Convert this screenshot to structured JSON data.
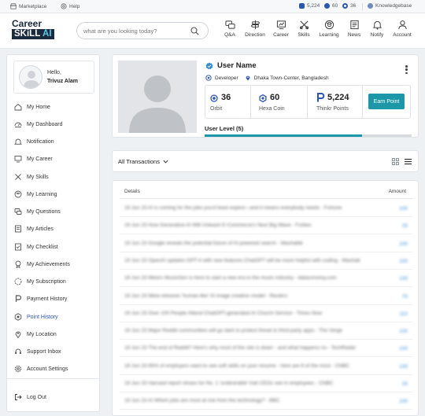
{
  "topbar": {
    "marketplace": "Marketplace",
    "help": "Help",
    "points": "5,224",
    "hexa": "60",
    "orbit": "36",
    "knowledgebase": "Knowledgebase"
  },
  "header": {
    "logo_top": "Career",
    "logo_bottom": "SKiLL",
    "logo_ai": "AI",
    "search_placeholder": "what are you looking today?",
    "nav": [
      "Q&A",
      "Direction",
      "Career",
      "Skills",
      "Learning",
      "News",
      "Notify",
      "Account"
    ]
  },
  "sidebar": {
    "greeting": "Hello,",
    "user": "Trivuz Alam",
    "items": [
      {
        "label": "My Home",
        "icon": "home-icon"
      },
      {
        "label": "My Dashboard",
        "icon": "dashboard-icon"
      },
      {
        "label": "Notification",
        "icon": "bell-icon"
      },
      {
        "label": "My Career",
        "icon": "career-icon"
      },
      {
        "label": "My Skills",
        "icon": "skills-icon"
      },
      {
        "label": "My Learning",
        "icon": "learning-icon"
      },
      {
        "label": "My Questions",
        "icon": "questions-icon"
      },
      {
        "label": "My Articles",
        "icon": "articles-icon"
      },
      {
        "label": "My Checklist",
        "icon": "checklist-icon"
      },
      {
        "label": "My Achievements",
        "icon": "achievements-icon"
      },
      {
        "label": "My Subscription",
        "icon": "subscription-icon"
      },
      {
        "label": "Payment History",
        "icon": "payment-icon"
      },
      {
        "label": "Point History",
        "icon": "points-icon",
        "active": true
      },
      {
        "label": "My Location",
        "icon": "location-icon"
      },
      {
        "label": "Support Inbox",
        "icon": "support-icon"
      },
      {
        "label": "Account Settings",
        "icon": "settings-icon"
      }
    ],
    "logout": "Log Out"
  },
  "profile": {
    "name": "User Name",
    "role": "Developer",
    "location": "Dhaka Town-Center, Bangladesh",
    "stats": [
      {
        "value": "36",
        "label": "Orbit"
      },
      {
        "value": "60",
        "label": "Hexa Coin"
      },
      {
        "value": "5,224",
        "label": "Thinkr Points"
      }
    ],
    "earn_button": "Earn Point",
    "level_label": "User Level (5)",
    "level_progress": 0.76
  },
  "transactions": {
    "filter": "All Transactions",
    "columns": {
      "details": "Details",
      "amount": "Amount"
    },
    "rows": [
      {
        "details": "19 Jun 23 AI is coming for the jobs you'd least expect—and it means everybody needs - Fortune",
        "amount": "100"
      },
      {
        "details": "19 Jun 23 How Generative AI Will Unleash E-Commerce's Next Big Wave - Forbes",
        "amount": "25"
      },
      {
        "details": "19 Jun 23 Google reveals the potential future of AI-powered search - Mashable",
        "amount": "100"
      },
      {
        "details": "19 Jun 23 OpenAI updates GPT-4 with new features ChatGPT will be more helpful with coding - Mashable",
        "amount": "100"
      },
      {
        "details": "19 Jun 23 Meta's MusicGen is here to start a new era in the music industry - dataconomy.com",
        "amount": "100"
      },
      {
        "details": "19 Jun 23 Meta releases 'human-like' AI image creation model - Reuters",
        "amount": "75"
      },
      {
        "details": "19 Jun 23 Over 100 People Attend ChatGPT-generated AI Church Service - Times Now",
        "amount": "110"
      },
      {
        "details": "19 Jun 23 Major Reddit communities will go dark to protest threat to third-party apps - The Verge",
        "amount": "100"
      },
      {
        "details": "19 Jun 23 The end of Reddit? Here's why most of the site is down - and what happens no - TechRadar",
        "amount": "100"
      },
      {
        "details": "19 Jun 23 65% of employers want to see soft skills on your resume - here are 8 of the most - CNBC",
        "amount": "100"
      },
      {
        "details": "19 Jun 23 Harvard report shows for No. 1 'undesirable' trait CEOs see in employees - CNBC",
        "amount": "25"
      },
      {
        "details": "19 Jun 23 AI Which jobs are most at risk from the technology? - BBC",
        "amount": "100"
      }
    ]
  },
  "colors": {
    "brand_dark": "#1b2b3f",
    "accent": "#1b97a8",
    "active": "#2c55b8",
    "link": "#3a8fd0"
  }
}
